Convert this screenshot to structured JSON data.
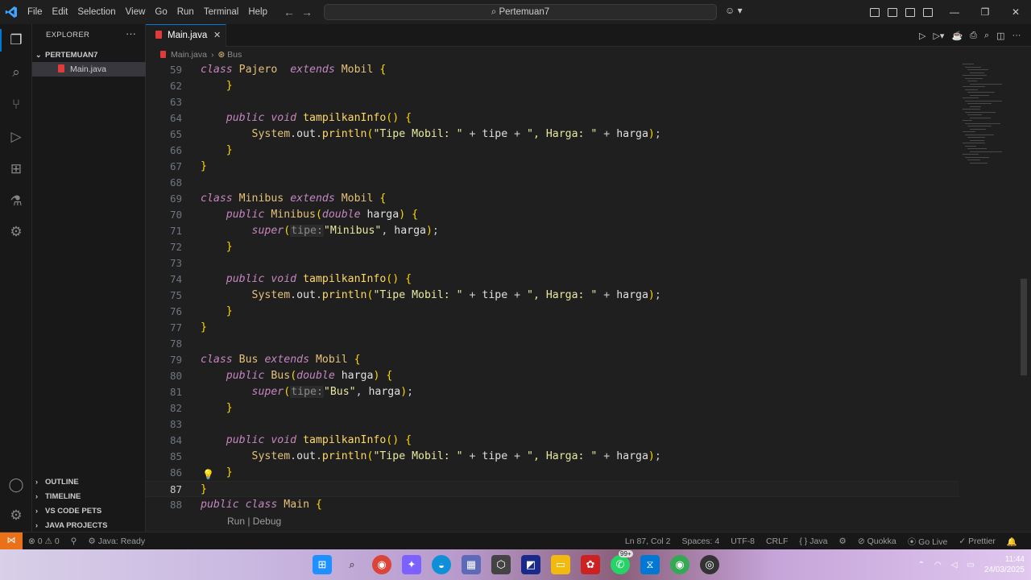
{
  "menu": [
    "File",
    "Edit",
    "Selection",
    "View",
    "Go",
    "Run",
    "Terminal",
    "Help"
  ],
  "command_center": "Pertemuan7",
  "sidebar": {
    "title": "EXPLORER",
    "folder": "PERTEMUAN7",
    "file": "Main.java",
    "panels": [
      "OUTLINE",
      "TIMELINE",
      "VS CODE PETS",
      "JAVA PROJECTS"
    ]
  },
  "tab": {
    "label": "Main.java"
  },
  "breadcrumb": {
    "file": "Main.java",
    "symbol": "Bus"
  },
  "code_lines": [
    {
      "n": "59",
      "t": "class Pajero  extends Mobil {"
    },
    {
      "n": "62",
      "t": "    }"
    },
    {
      "n": "63",
      "t": ""
    },
    {
      "n": "64",
      "t": "    public void tampilkanInfo() {"
    },
    {
      "n": "65",
      "t": "        System.out.println(\"Tipe Mobil: \" + tipe + \", Harga: \" + harga);"
    },
    {
      "n": "66",
      "t": "    }"
    },
    {
      "n": "67",
      "t": "}"
    },
    {
      "n": "68",
      "t": ""
    },
    {
      "n": "69",
      "t": "class Minibus extends Mobil {"
    },
    {
      "n": "70",
      "t": "    public Minibus(double harga) {"
    },
    {
      "n": "71",
      "t": "        super(tipe:\"Minibus\", harga);"
    },
    {
      "n": "72",
      "t": "    }"
    },
    {
      "n": "73",
      "t": ""
    },
    {
      "n": "74",
      "t": "    public void tampilkanInfo() {"
    },
    {
      "n": "75",
      "t": "        System.out.println(\"Tipe Mobil: \" + tipe + \", Harga: \" + harga);"
    },
    {
      "n": "76",
      "t": "    }"
    },
    {
      "n": "77",
      "t": "}"
    },
    {
      "n": "78",
      "t": ""
    },
    {
      "n": "79",
      "t": "class Bus extends Mobil {"
    },
    {
      "n": "80",
      "t": "    public Bus(double harga) {"
    },
    {
      "n": "81",
      "t": "        super(tipe:\"Bus\", harga);"
    },
    {
      "n": "82",
      "t": "    }"
    },
    {
      "n": "83",
      "t": ""
    },
    {
      "n": "84",
      "t": "    public void tampilkanInfo() {"
    },
    {
      "n": "85",
      "t": "        System.out.println(\"Tipe Mobil: \" + tipe + \", Harga: \" + harga);"
    },
    {
      "n": "86",
      "t": "    }"
    },
    {
      "n": "87",
      "t": "}"
    },
    {
      "n": "88",
      "t": "public class Main {"
    }
  ],
  "codelens": "Run | Debug",
  "status": {
    "errors": "0",
    "warnings": "0",
    "java_status": "Java: Ready",
    "position": "Ln 87, Col 2",
    "spaces": "Spaces: 4",
    "encoding": "UTF-8",
    "eol": "CRLF",
    "language": "Java",
    "quokka": "Quokka",
    "golive": "Go Live",
    "prettier": "Prettier"
  },
  "taskbar": {
    "badge": "99+",
    "time": "11:44",
    "date": "24/03/2025"
  },
  "colors": {
    "accent": "#0078d4",
    "remote": "#e8711a",
    "java_icon": "#e03b3b"
  }
}
